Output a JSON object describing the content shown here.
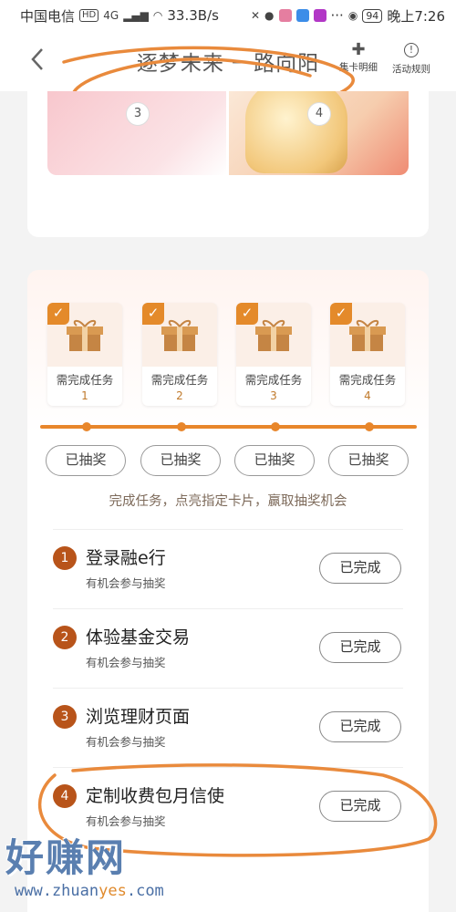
{
  "status_bar": {
    "carrier": "中国电信",
    "network": "4G",
    "speed": "33.3B/s",
    "battery": "94",
    "time": "晚上7:26",
    "more": "···"
  },
  "header": {
    "title": "逐梦未来 一路向阳",
    "detail_label": "集卡明细",
    "rules_label": "活动规则"
  },
  "top_card": {
    "step_a": "3",
    "step_b": "4"
  },
  "gifts": [
    {
      "label": "需完成任务",
      "num": "1"
    },
    {
      "label": "需完成任务",
      "num": "2"
    },
    {
      "label": "需完成任务",
      "num": "3"
    },
    {
      "label": "需完成任务",
      "num": "4"
    }
  ],
  "draw_buttons": [
    "已抽奖",
    "已抽奖",
    "已抽奖",
    "已抽奖"
  ],
  "hint": "完成任务，点亮指定卡片，赢取抽奖机会",
  "tasks": [
    {
      "num": "1",
      "name": "登录融e行",
      "sub": "有机会参与抽奖",
      "status": "已完成"
    },
    {
      "num": "2",
      "name": "体验基金交易",
      "sub": "有机会参与抽奖",
      "status": "已完成"
    },
    {
      "num": "3",
      "name": "浏览理财页面",
      "sub": "有机会参与抽奖",
      "status": "已完成"
    },
    {
      "num": "4",
      "name": "定制收费包月信使",
      "sub": "有机会参与抽奖",
      "status": "已完成"
    }
  ],
  "watermark": {
    "big": "好赚网",
    "url_a": "www.zhuan",
    "url_b": "yes",
    "url_c": ".com"
  },
  "colors": {
    "accent": "#e8862b",
    "task_badge": "#b8541a",
    "annotation": "#e98a3c"
  }
}
